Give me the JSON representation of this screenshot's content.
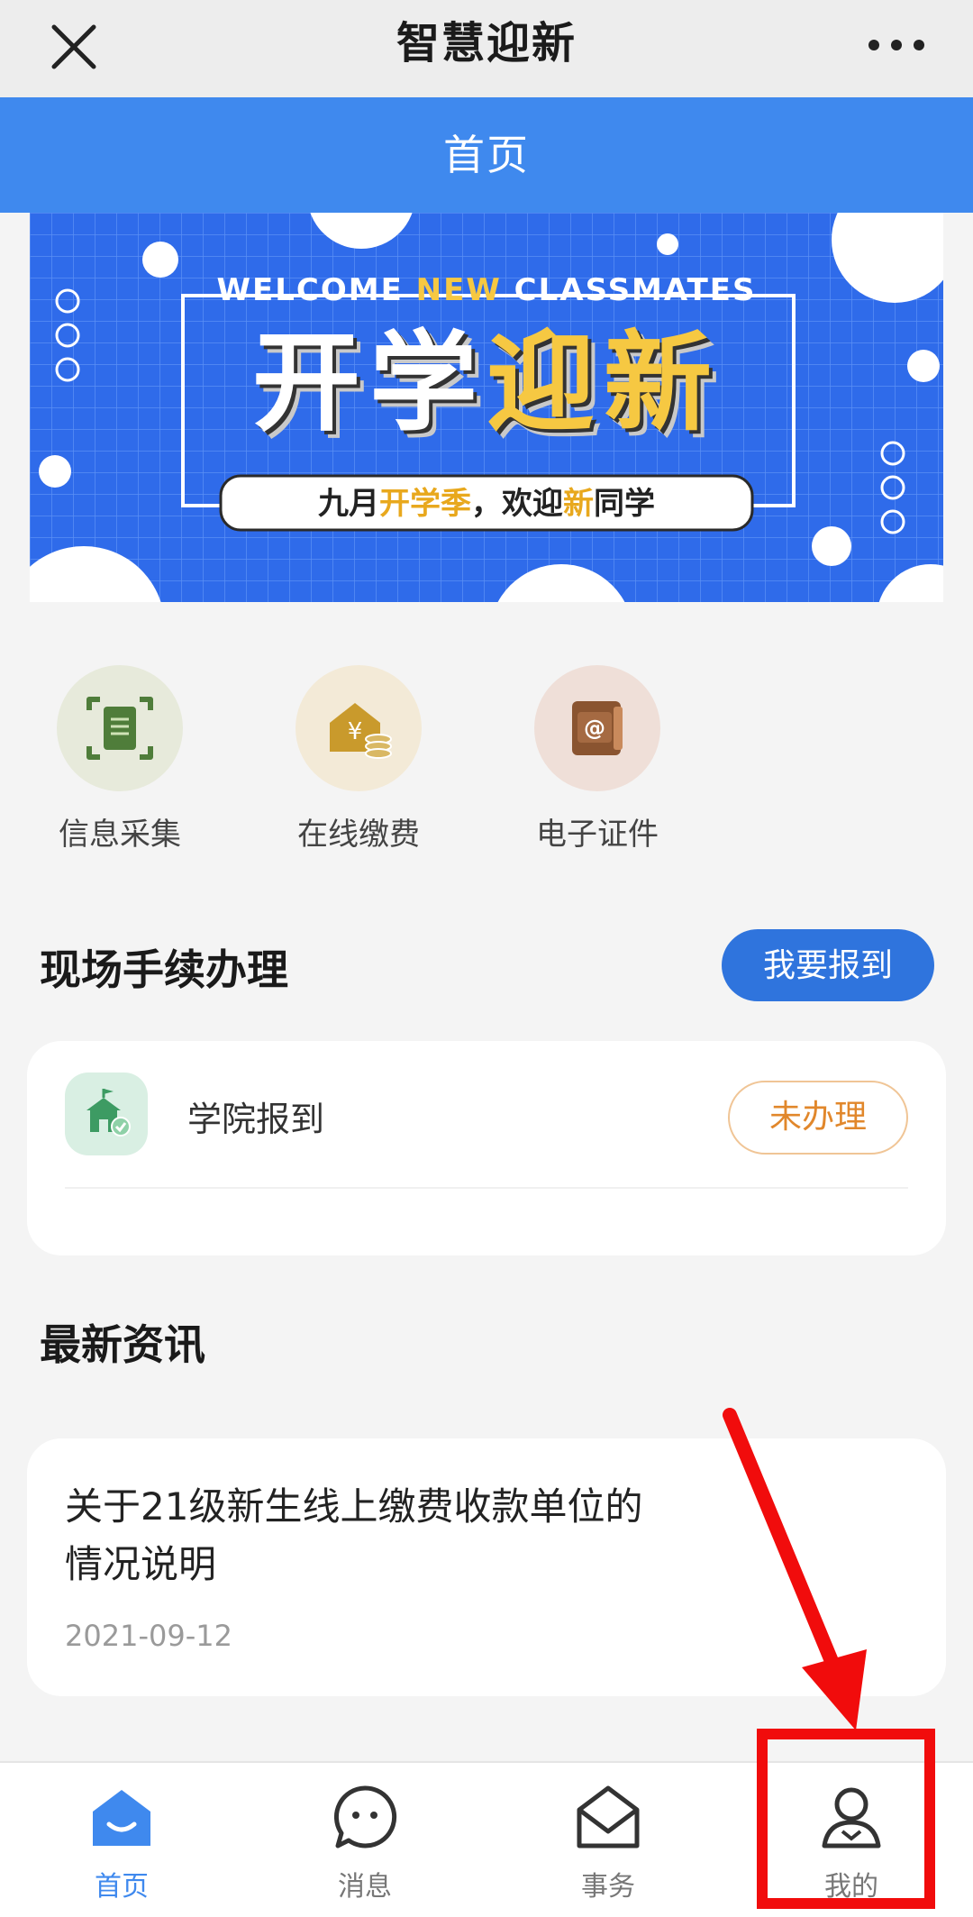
{
  "topbar": {
    "title": "智慧迎新",
    "close_icon": "close-icon",
    "more_icon": "more-dots-icon"
  },
  "header": {
    "title": "首页"
  },
  "banner": {
    "welcome_text_1": "WELCOME ",
    "welcome_text_2": "NEW",
    "welcome_text_3": " CLASSMATES",
    "headline_white": "开学",
    "headline_yellow": "迎新",
    "tagline_1": "九月",
    "tagline_2": "开学季",
    "tagline_3": "，欢迎",
    "tagline_4": "新",
    "tagline_5": "同学",
    "colors": {
      "background": "#2f6bea",
      "accent": "#f6c842"
    }
  },
  "quick_actions": [
    {
      "label": "信息采集",
      "icon": "document-scan-icon",
      "bg": "#e7eadb"
    },
    {
      "label": "在线缴费",
      "icon": "payment-house-icon",
      "bg": "#f3ead7"
    },
    {
      "label": "电子证件",
      "icon": "id-book-icon",
      "bg": "#efdfd8"
    }
  ],
  "onsite": {
    "title": "现场手续办理",
    "report_button": "我要报到",
    "items": [
      {
        "label": "学院报到",
        "status": "未办理",
        "icon": "school-check-icon"
      }
    ]
  },
  "news": {
    "title": "最新资讯",
    "items": [
      {
        "title": "关于21级新生线上缴费收款单位的情况说明",
        "date": "2021-09-12"
      }
    ]
  },
  "tabbar": {
    "tabs": [
      {
        "label": "首页",
        "icon": "home-icon",
        "active": true
      },
      {
        "label": "消息",
        "icon": "message-icon",
        "active": false
      },
      {
        "label": "事务",
        "icon": "affairs-icon",
        "active": false
      },
      {
        "label": "我的",
        "icon": "profile-icon",
        "active": false
      }
    ]
  },
  "colors": {
    "primary_blue": "#3f89ee",
    "button_blue": "#2f74dd",
    "status_orange": "#e1872b",
    "annotation_red": "#f10c0c"
  }
}
